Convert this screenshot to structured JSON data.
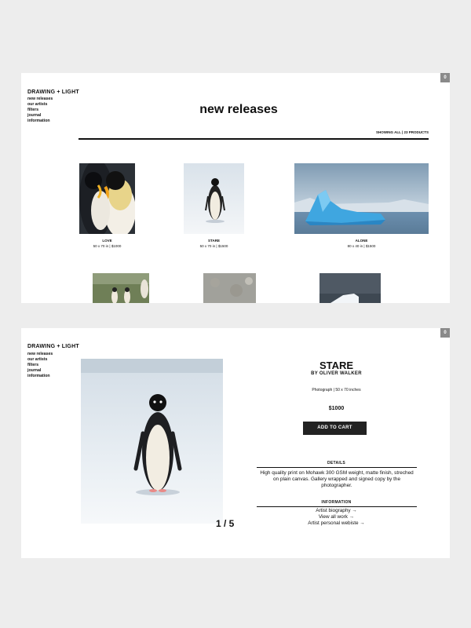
{
  "site": {
    "brand": "DRAWING + LIGHT",
    "nav": [
      "new releases",
      "our artists",
      "filters",
      "journal",
      "information"
    ],
    "cart_count": "0"
  },
  "listing": {
    "title": "new releases",
    "count_text": "SHOWING ALL | 23 PRODUCTS",
    "products": [
      {
        "name": "LOVE",
        "meta": "50 x 70 in | $1000"
      },
      {
        "name": "STARE",
        "meta": "50 x 70 in | $1500"
      },
      {
        "name": "ALONE",
        "meta": "80 x 40 in | $1500"
      }
    ]
  },
  "product": {
    "title": "STARE",
    "byline": "BY OLIVER WALKER",
    "spec": "Photograph | 50 x 70 inches",
    "price": "$1000",
    "add_to_cart": "ADD TO CART",
    "details_heading": "DETAILS",
    "details_text": "High quality print on Mohawk 300 GSM weight, matte finish, streched on plain canvas. Gallery wrapped and signed copy by the photographer.",
    "information_heading": "INFORMATION",
    "links": [
      "Artist biography →",
      "View all work →",
      "Artist personal webiste →"
    ],
    "counter": "1 / 5"
  },
  "icons": {
    "cart": "cart-icon",
    "penguin": "penguin-photo",
    "iceberg": "iceberg-photo"
  }
}
